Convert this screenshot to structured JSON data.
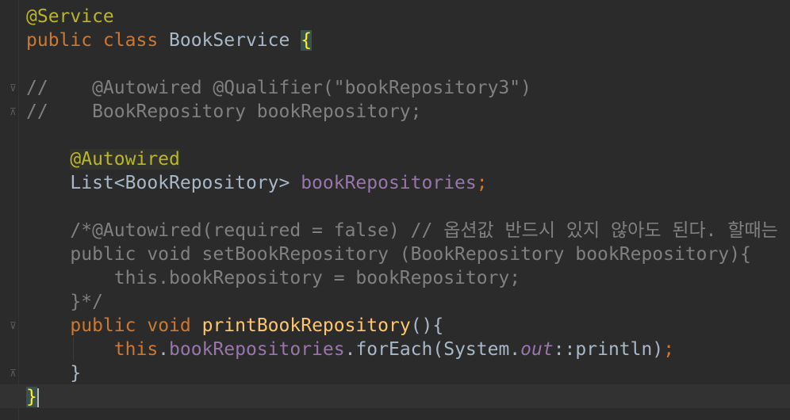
{
  "editor": {
    "language": "java",
    "theme": "Darcula",
    "lines": [
      {
        "id": "l1",
        "tokens": [
          {
            "t": "@Service",
            "c": "ann"
          }
        ]
      },
      {
        "id": "l2",
        "tokens": [
          {
            "t": "public class ",
            "c": "kw"
          },
          {
            "t": "BookService ",
            "c": "plain"
          },
          {
            "t": "{",
            "c": "brace-match"
          }
        ]
      },
      {
        "id": "l3",
        "tokens": []
      },
      {
        "id": "l4",
        "tokens": [
          {
            "t": "//    @Autowired @Qualifier(\"bookRepository3\")",
            "c": "cmt"
          }
        ]
      },
      {
        "id": "l5",
        "tokens": [
          {
            "t": "//    BookRepository bookRepository;",
            "c": "cmt"
          }
        ]
      },
      {
        "id": "l6",
        "tokens": []
      },
      {
        "id": "l7",
        "tokens": [
          {
            "t": "    ",
            "c": "plain"
          },
          {
            "t": "@Autowired",
            "c": "ann-hl"
          }
        ]
      },
      {
        "id": "l8",
        "tokens": [
          {
            "t": "    List<BookRepository> ",
            "c": "plain"
          },
          {
            "t": "bookRepositories",
            "c": "fld"
          },
          {
            "t": ";",
            "c": "kw"
          }
        ]
      },
      {
        "id": "l9",
        "tokens": []
      },
      {
        "id": "l10",
        "tokens": [
          {
            "t": "    /*@Autowired(required = false) // 옵션값 반드시 있지 않아도 된다. 할때는 f",
            "c": "cmt"
          }
        ]
      },
      {
        "id": "l11",
        "tokens": [
          {
            "t": "    public void setBookRepository (BookRepository bookRepository){",
            "c": "cmt"
          }
        ]
      },
      {
        "id": "l12",
        "tokens": [
          {
            "t": "        this.bookRepository = bookRepository;",
            "c": "cmt"
          }
        ]
      },
      {
        "id": "l13",
        "tokens": [
          {
            "t": "    }*/",
            "c": "cmt"
          }
        ]
      },
      {
        "id": "l14",
        "tokens": [
          {
            "t": "    ",
            "c": "plain"
          },
          {
            "t": "public",
            "c": "kw"
          },
          {
            "t": " ",
            "c": "plain"
          },
          {
            "t": "void ",
            "c": "kw"
          },
          {
            "t": "printBookRepository",
            "c": "fn"
          },
          {
            "t": "(){",
            "c": "plain"
          }
        ]
      },
      {
        "id": "l15",
        "tokens": [
          {
            "t": "        ",
            "c": "plain"
          },
          {
            "t": "this",
            "c": "kw"
          },
          {
            "t": ".",
            "c": "plain"
          },
          {
            "t": "bookRepositories",
            "c": "fld"
          },
          {
            "t": ".forEach(System.",
            "c": "plain"
          },
          {
            "t": "out",
            "c": "static"
          },
          {
            "t": "::println)",
            "c": "plain"
          },
          {
            "t": ";",
            "c": "kw"
          }
        ]
      },
      {
        "id": "l16",
        "tokens": [
          {
            "t": "    }",
            "c": "plain"
          }
        ]
      },
      {
        "id": "l17",
        "tokens": [
          {
            "t": "}",
            "c": "brace-match"
          }
        ]
      }
    ],
    "fold_markers": [
      {
        "line": 4,
        "glyph": "⊽"
      },
      {
        "line": 5,
        "glyph": "⊼"
      },
      {
        "line": 14,
        "glyph": "⊽"
      },
      {
        "line": 16,
        "glyph": "⊼"
      }
    ]
  }
}
